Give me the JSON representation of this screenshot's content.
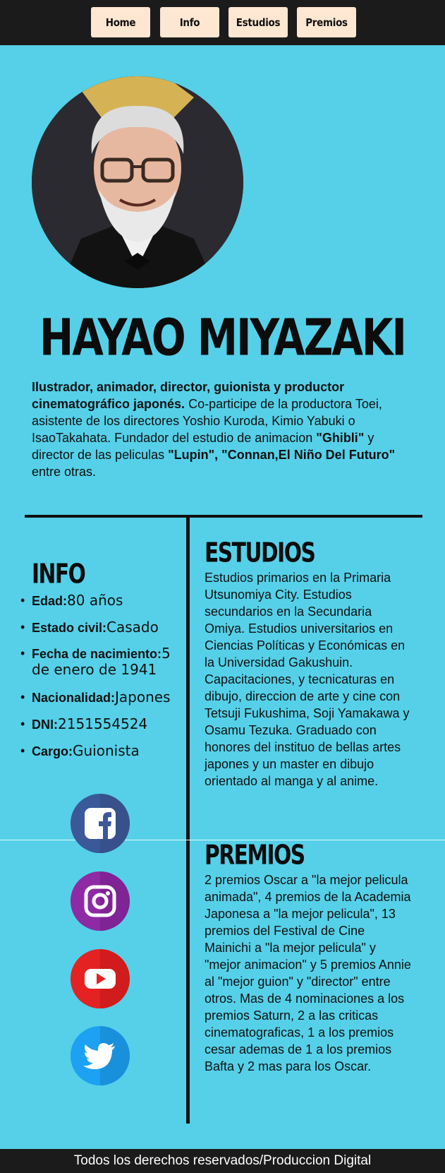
{
  "nav": {
    "home": "Home",
    "info": "Info",
    "estudios": "Estudios",
    "premios": "Premios"
  },
  "hero": {
    "name": "HAYAO MIYAZAKI",
    "bio_role": "Ilustrador, animador, director, guionista y productor cinematográfico japonés.",
    "bio_text1": " Co-participe de la productora Toei, asistente de los directores Yoshio Kuroda, Kimio Yabuki o IsaoTakahata. Fundador del estudio de animacion ",
    "bio_ghibli": "\"Ghibli\"",
    "bio_text2": " y director de las peliculas ",
    "bio_films": "\"Lupin\", \"Connan,El Niño Del Futuro\"",
    "bio_text3": " entre otras."
  },
  "info": {
    "title": "INFO",
    "items": [
      {
        "key": "Edad:",
        "value": "80 años"
      },
      {
        "key": "Estado civil:",
        "value": "Casado"
      },
      {
        "key": "Fecha de nacimiento:",
        "value": "5 de enero de 1941"
      },
      {
        "key": "Nacionalidad:",
        "value": "Japones"
      },
      {
        "key": "DNI:",
        "value": "2151554524"
      },
      {
        "key": "Cargo:",
        "value": "Guionista"
      }
    ]
  },
  "estudios": {
    "title": "ESTUDIOS",
    "text": "Estudios primarios en la Primaria Utsunomiya City. Estudios secundarios en la Secundaria Omiya. Estudios universitarios en Ciencias Políticas y Económicas en la Universidad Gakushuin. Capacitaciones, y tecnicaturas en dibujo, direccion de arte y cine con Tetsuji Fukushima, Soji Yamakawa y Osamu Tezuka. Graduado con honores del instituo de bellas artes japones y un master en dibujo orientado al manga y al anime."
  },
  "premios": {
    "title": "PREMIOS",
    "text": "2 premios Oscar a \"la mejor pelicula animada\", 4 premios de la Academia Japonesa a \"la mejor pelicula\", 13 premios del Festival de Cine Mainichi a \"la mejor pelicula\" y \"mejor animacion\" y 5 premios Annie al \"mejor guion\" y \"director\" entre otros. Mas de 4 nominaciones a los premios Saturn, 2 a las criticas cinematograficas, 1 a los premios cesar ademas de 1 a los premios Bafta y 2 mas para los Oscar."
  },
  "social": [
    "facebook-icon",
    "instagram-icon",
    "youtube-icon",
    "twitter-icon"
  ],
  "footer": "Todos los derechos reservados/Produccion Digital",
  "colors": {
    "background": "#55d0e8",
    "nav_bg": "#1b1b1b",
    "button_bg": "#fde6d2"
  }
}
